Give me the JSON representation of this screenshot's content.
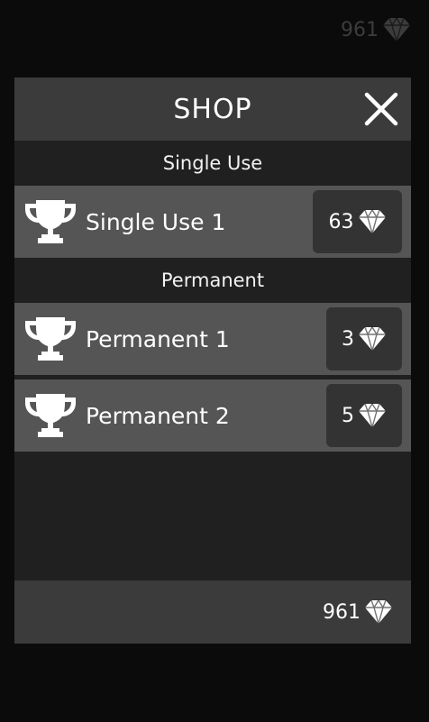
{
  "top_bar": {
    "gem_count": "961",
    "gem_icon": "diamond-icon",
    "color": "#3c3c3c"
  },
  "shop": {
    "title": "SHOP",
    "close_icon": "close-icon",
    "sections": [
      {
        "label": "Single Use",
        "items": [
          {
            "icon": "trophy-icon",
            "name": "Single Use 1",
            "price": "63"
          }
        ]
      },
      {
        "label": "Permanent",
        "items": [
          {
            "icon": "trophy-icon",
            "name": "Permanent 1",
            "price": "3"
          },
          {
            "icon": "trophy-icon",
            "name": "Permanent 2",
            "price": "5"
          }
        ]
      }
    ],
    "footer": {
      "gem_count": "961",
      "gem_icon": "diamond-icon"
    }
  },
  "colors": {
    "background": "#0b0b0b",
    "panel": "#202020",
    "header": "#3b3b3b",
    "item_row": "#555555",
    "price_button": "#333333",
    "text": "#ffffff"
  }
}
